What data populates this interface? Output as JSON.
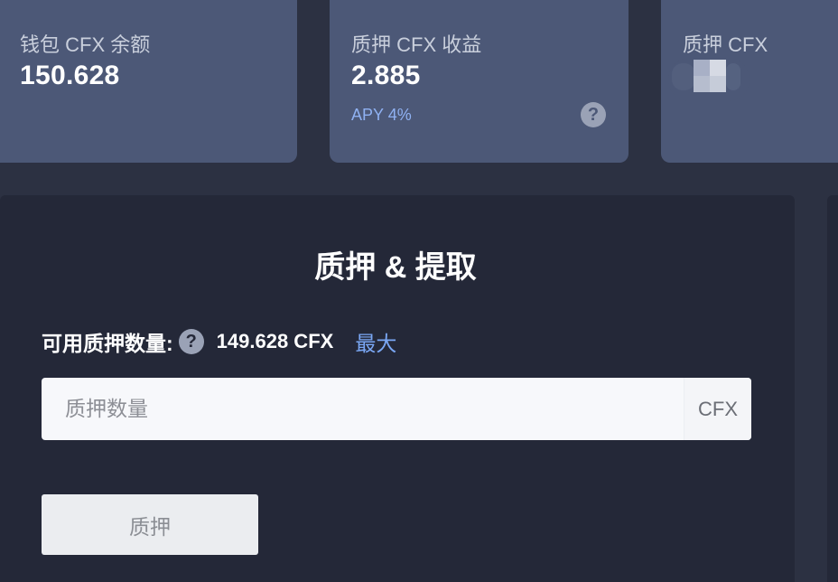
{
  "stats": {
    "wallet": {
      "label": "钱包 CFX 余额",
      "value": "150.628"
    },
    "rewards": {
      "label": "质押 CFX 收益",
      "value": "2.885",
      "apy": "APY 4%",
      "help": "?"
    },
    "staked": {
      "label": "质押 CFX"
    }
  },
  "panel": {
    "title": "质押 & 提取",
    "available_label": "可用质押数量:",
    "available_help": "?",
    "available_amount": "149.628 CFX",
    "max_label": "最大",
    "input_placeholder": "质押数量",
    "input_value": "",
    "input_unit": "CFX",
    "stake_button": "质押"
  }
}
